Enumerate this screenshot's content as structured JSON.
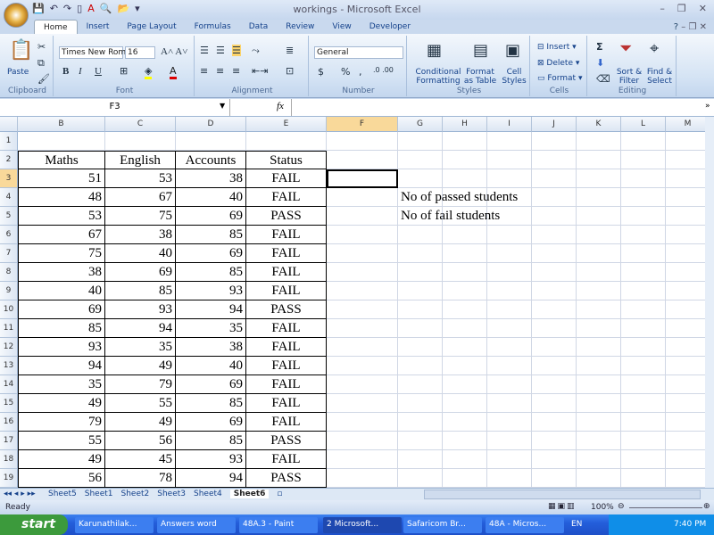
{
  "window": {
    "title": "workings - Microsoft Excel"
  },
  "ribbon_tabs": [
    "Home",
    "Insert",
    "Page Layout",
    "Formulas",
    "Data",
    "Review",
    "View",
    "Developer"
  ],
  "ribbon": {
    "clipboard": {
      "label": "Clipboard",
      "paste": "Paste"
    },
    "font": {
      "label": "Font",
      "name": "Times New Rom",
      "size": "16",
      "bold": "B",
      "italic": "I",
      "underline": "U"
    },
    "alignment": {
      "label": "Alignment"
    },
    "number": {
      "label": "Number",
      "format": "General",
      "currency": "$",
      "percent": "%",
      "comma": ","
    },
    "styles": {
      "label": "Styles",
      "conditional": "Conditional Formatting",
      "format_table": "Format as Table",
      "cell_styles": "Cell Styles"
    },
    "cells": {
      "label": "Cells",
      "insert": "Insert",
      "delete": "Delete",
      "format": "Format"
    },
    "editing": {
      "label": "Editing",
      "sort": "Sort & Filter",
      "find": "Find & Select",
      "sum": "Σ"
    }
  },
  "formula_bar": {
    "name_box": "F3",
    "fx": "fx",
    "value": ""
  },
  "columns": [
    "B",
    "C",
    "D",
    "E",
    "F",
    "G",
    "H",
    "I",
    "J",
    "K",
    "L",
    "M"
  ],
  "table": {
    "headers": [
      "Maths",
      "English",
      "Accounts",
      "Status"
    ],
    "rows": [
      [
        51,
        53,
        38,
        "FAIL"
      ],
      [
        48,
        67,
        40,
        "FAIL"
      ],
      [
        53,
        75,
        69,
        "PASS"
      ],
      [
        67,
        38,
        85,
        "FAIL"
      ],
      [
        75,
        40,
        69,
        "FAIL"
      ],
      [
        38,
        69,
        85,
        "FAIL"
      ],
      [
        40,
        85,
        93,
        "FAIL"
      ],
      [
        69,
        93,
        94,
        "PASS"
      ],
      [
        85,
        94,
        35,
        "FAIL"
      ],
      [
        93,
        35,
        38,
        "FAIL"
      ],
      [
        94,
        49,
        40,
        "FAIL"
      ],
      [
        35,
        79,
        69,
        "FAIL"
      ],
      [
        49,
        55,
        85,
        "FAIL"
      ],
      [
        79,
        49,
        69,
        "FAIL"
      ],
      [
        55,
        56,
        85,
        "PASS"
      ],
      [
        49,
        45,
        93,
        "FAIL"
      ],
      [
        56,
        78,
        94,
        "PASS"
      ]
    ]
  },
  "notes": {
    "passed": "No of passed students",
    "failed": "No of fail students"
  },
  "sheets": [
    "Sheet5",
    "Sheet1",
    "Sheet2",
    "Sheet3",
    "Sheet4",
    "Sheet6"
  ],
  "active_sheet": "Sheet6",
  "status": {
    "text": "Ready",
    "zoom": "100%"
  },
  "taskbar": {
    "start": "start",
    "items": [
      "Karunathilak...",
      "Answers word",
      "48A.3 - Paint",
      "2 Microsoft...",
      "Safaricom Br...",
      "48A - Micros..."
    ],
    "lang": "EN",
    "clock": "7:40 PM"
  }
}
